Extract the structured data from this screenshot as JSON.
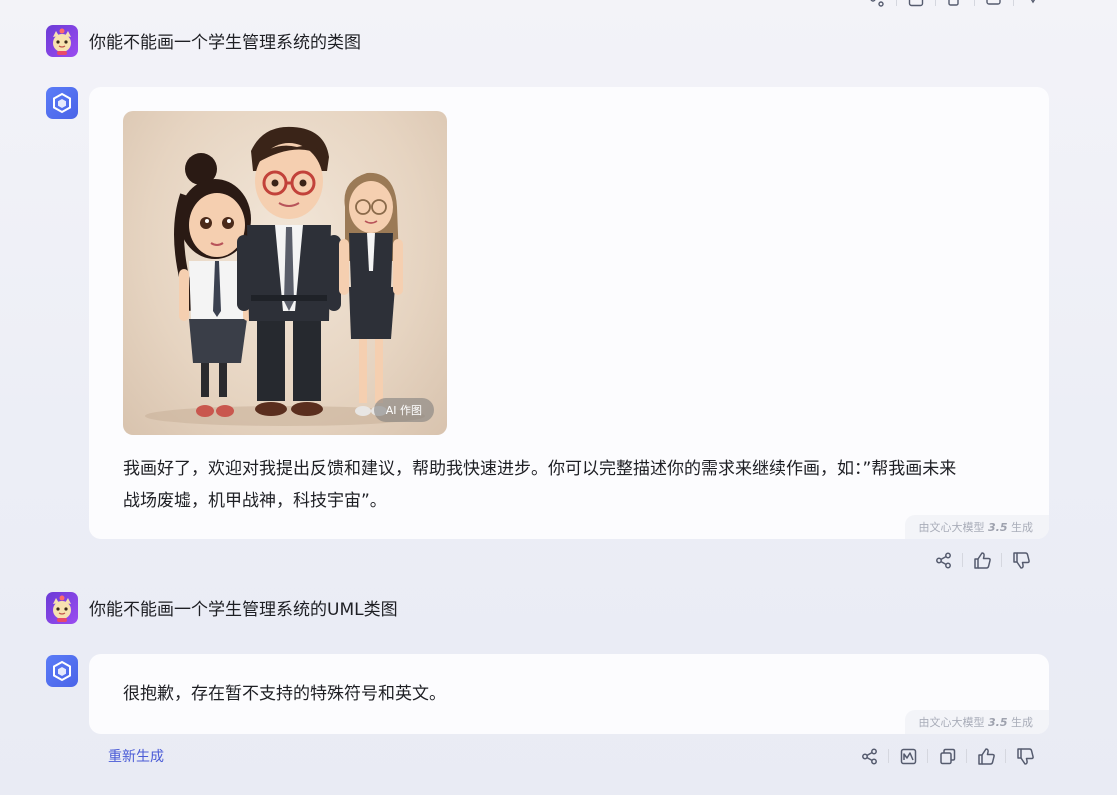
{
  "conversation": {
    "msg1_user": "你能不能画一个学生管理系统的类图",
    "msg1_bot_text_line1": "我画好了，欢迎对我提出反馈和建议，帮助我快速进步。你可以完整描述你的需求来继续作画，如：”帮我画未来",
    "msg1_bot_text_line2": "战场废墟，机甲战神，科技宇宙”。",
    "image_badge": "AI 作图",
    "msg2_user": "你能不能画一个学生管理系统的UML类图",
    "msg2_bot_text": "很抱歉，存在暂不支持的特殊符号和英文。",
    "regenerate_label": "重新生成"
  },
  "watermark": {
    "prefix": "由文心大模型 ",
    "version": "3.5",
    "suffix": " 生成"
  },
  "icons": {
    "share": "share-icon",
    "like": "thumbs-up-icon",
    "dislike": "thumbs-down-icon",
    "chart": "chart-icon",
    "copy": "copy-icon"
  },
  "colors": {
    "accent": "#4a5bd6",
    "bot_avatar": "#5b7cf7",
    "user_avatar": "#7b42e0"
  }
}
